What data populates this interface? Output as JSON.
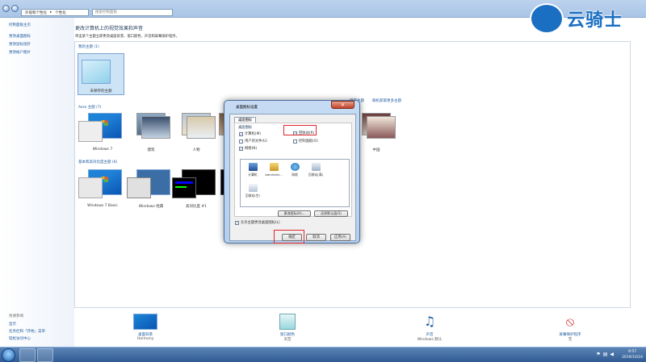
{
  "window": {
    "breadcrumb": [
      "外观和个性化",
      "个性化"
    ],
    "search_placeholder": "搜索控制面板"
  },
  "sidebar": {
    "home": "控制面板主页",
    "links": [
      "更改桌面图标",
      "更改鼠标指针",
      "更改帐户图片"
    ],
    "see_also_title": "另请参阅",
    "see_also": [
      "显示",
      "任务栏和「开始」菜单",
      "轻松访问中心"
    ]
  },
  "main": {
    "title": "更改计算机上的视觉效果和声音",
    "description": "单击某个主题立即更改桌面背景、窗口颜色、声音和屏幕保护程序。",
    "my_themes": "我的主题 (1)",
    "unsaved_theme": "未保存的主题",
    "aero_themes": "Aero 主题 (7)",
    "aero_items": [
      "Windows 7",
      "建筑",
      "人物",
      "中国"
    ],
    "basic_themes": "基本和高对比度主题 (6)",
    "basic_items": [
      "Windows 7 Basic",
      "Windows 经典",
      "高对比度 #1"
    ],
    "save_theme_link": "保存主题",
    "online_link": "联机获取更多主题"
  },
  "bottom": [
    {
      "title": "桌面背景",
      "sub": "Harmony",
      "icon": "desktop-background-icon"
    },
    {
      "title": "窗口颜色",
      "sub": "天空",
      "icon": "window-color-icon"
    },
    {
      "title": "声音",
      "sub": "Windows 默认",
      "icon": "sound-icon"
    },
    {
      "title": "屏幕保护程序",
      "sub": "无",
      "icon": "screensaver-icon"
    }
  ],
  "taskbar": {
    "time": "9:57",
    "date": "2019/10/24"
  },
  "dialog": {
    "title": "桌面图标设置",
    "close": "✕",
    "tab": "桌面图标",
    "group_label": "桌面图标",
    "checkboxes": [
      {
        "label": "计算机(M)",
        "checked": true
      },
      {
        "label": "回收站(R)",
        "checked": true
      },
      {
        "label": "用户的文件(U)",
        "checked": false
      },
      {
        "label": "控制面板(O)",
        "checked": false
      },
      {
        "label": "网络(N)",
        "checked": true
      }
    ],
    "icons": [
      "计算机",
      "Administr...",
      "网络",
      "回收站(满)",
      "回收站(空)"
    ],
    "change_icon": "更改图标(H)...",
    "restore_default": "还原默认值(S)",
    "allow_themes": "允许主题更改桌面图标(L)",
    "ok": "确定",
    "cancel": "取消",
    "apply": "应用(A)"
  },
  "watermark": {
    "text": "云骑士"
  }
}
